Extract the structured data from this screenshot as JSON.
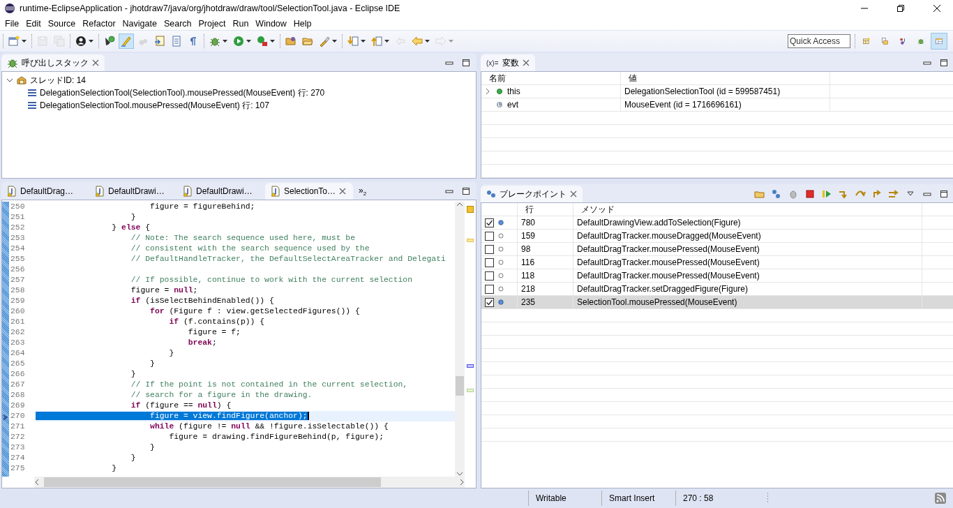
{
  "window": {
    "title": "runtime-EclipseApplication - jhotdraw7/java/org/jhotdraw/draw/tool/SelectionTool.java - Eclipse IDE"
  },
  "menu": [
    "File",
    "Edit",
    "Source",
    "Refactor",
    "Navigate",
    "Search",
    "Project",
    "Run",
    "Window",
    "Help"
  ],
  "toolbar": {
    "groups": [
      [
        {
          "kind": "new",
          "dropdown": true,
          "pressed": false,
          "disabled": false
        }
      ],
      [
        {
          "kind": "save",
          "dropdown": false,
          "pressed": false,
          "disabled": true
        },
        {
          "kind": "save-all",
          "dropdown": false,
          "pressed": false,
          "disabled": true
        }
      ],
      [
        {
          "kind": "profile",
          "dropdown": true,
          "pressed": false,
          "disabled": false
        }
      ],
      [
        {
          "kind": "pin",
          "dropdown": false,
          "pressed": false,
          "disabled": false
        },
        {
          "kind": "pen",
          "dropdown": false,
          "pressed": true,
          "disabled": false
        },
        {
          "kind": "cloud",
          "dropdown": false,
          "pressed": false,
          "disabled": true
        },
        {
          "kind": "doc-arrow",
          "dropdown": false,
          "pressed": false,
          "disabled": false
        },
        {
          "kind": "doc",
          "dropdown": false,
          "pressed": false,
          "disabled": false
        },
        {
          "kind": "pilcrow",
          "dropdown": false,
          "pressed": false,
          "disabled": false
        }
      ],
      [
        {
          "kind": "bug",
          "dropdown": true,
          "pressed": false,
          "disabled": false
        },
        {
          "kind": "play",
          "dropdown": true,
          "pressed": false,
          "disabled": false
        },
        {
          "kind": "play-box",
          "dropdown": true,
          "pressed": false,
          "disabled": false
        }
      ],
      [
        {
          "kind": "folder-open",
          "dropdown": false,
          "pressed": false,
          "disabled": false
        },
        {
          "kind": "folder",
          "dropdown": false,
          "pressed": false,
          "disabled": false
        },
        {
          "kind": "brush",
          "dropdown": true,
          "pressed": false,
          "disabled": false
        }
      ],
      [
        {
          "kind": "arrow-down",
          "dropdown": true,
          "pressed": false,
          "disabled": false
        },
        {
          "kind": "arrow-up",
          "dropdown": true,
          "pressed": false,
          "disabled": false
        },
        {
          "kind": "arrow-back",
          "dropdown": false,
          "pressed": false,
          "disabled": true
        },
        {
          "kind": "arrow-left",
          "dropdown": true,
          "pressed": false,
          "disabled": false
        },
        {
          "kind": "arrow-right",
          "dropdown": true,
          "pressed": false,
          "disabled": true
        }
      ]
    ]
  },
  "quick_access": {
    "placeholder": "Quick Access"
  },
  "perspectives": [
    {
      "kind": "perspective",
      "selected": false
    },
    {
      "kind": "folder-doc",
      "selected": false
    },
    {
      "kind": "git",
      "selected": false
    },
    {
      "kind": "bug",
      "selected": false
    },
    {
      "kind": "layout",
      "selected": true
    }
  ],
  "call_stack": {
    "title": "呼び出しスタック",
    "threads": [
      {
        "label": "スレッドID: 14",
        "expanded": true,
        "children": [
          {
            "label": "DelegationSelectionTool(SelectionTool).mousePressed(MouseEvent) 行: 270"
          },
          {
            "label": "DelegationSelectionTool.mousePressed(MouseEvent) 行: 107"
          }
        ]
      }
    ]
  },
  "variables": {
    "prefix": "(x)=",
    "title": "変数",
    "columns": [
      "名前",
      "値"
    ],
    "rows": [
      {
        "name": "this",
        "value": "DelegationSelectionTool  (id = 599587451)",
        "expandable": true,
        "kind": "field"
      },
      {
        "name": "evt",
        "value": "MouseEvent  (id = 1716696161)",
        "expandable": false,
        "kind": "local"
      }
    ]
  },
  "editor": {
    "tabs": [
      {
        "label": "DefaultDrag…",
        "selected": false
      },
      {
        "label": "DefaultDrawi…",
        "selected": false
      },
      {
        "label": "DefaultDrawi…",
        "selected": false
      },
      {
        "label": "SelectionTo…",
        "selected": true
      }
    ],
    "overflow": "»",
    "overflow_count": "2",
    "lines": [
      {
        "number": "250",
        "current": false,
        "segments": [
          {
            "kind": "code",
            "text": "                        figure = figureBehind;"
          }
        ]
      },
      {
        "number": "251",
        "current": false,
        "segments": [
          {
            "kind": "code",
            "text": "                    }"
          }
        ]
      },
      {
        "number": "252",
        "current": false,
        "segments": [
          {
            "kind": "code",
            "text": "                } "
          },
          {
            "kind": "keyword",
            "text": "else"
          },
          {
            "kind": "code",
            "text": " {"
          }
        ]
      },
      {
        "number": "253",
        "current": false,
        "segments": [
          {
            "kind": "comment",
            "text": "                    // Note: The search sequence used here, must be"
          }
        ]
      },
      {
        "number": "254",
        "current": false,
        "segments": [
          {
            "kind": "comment",
            "text": "                    // consistent with the search sequence used by the"
          }
        ]
      },
      {
        "number": "255",
        "current": false,
        "segments": [
          {
            "kind": "comment",
            "text": "                    // DefaultHandleTracker, the DefaultSelectAreaTracker and Delegati"
          }
        ]
      },
      {
        "number": "256",
        "current": false
      },
      {
        "number": "257",
        "current": false,
        "segments": [
          {
            "kind": "comment",
            "text": "                    // If possible, continue to work with the current selection"
          }
        ]
      },
      {
        "number": "258",
        "current": false,
        "segments": [
          {
            "kind": "code",
            "text": "                    figure = "
          },
          {
            "kind": "keyword",
            "text": "null"
          },
          {
            "kind": "code",
            "text": ";"
          }
        ]
      },
      {
        "number": "259",
        "current": false,
        "segments": [
          {
            "kind": "keyword",
            "text": "                    if"
          },
          {
            "kind": "code",
            "text": " (isSelectBehindEnabled()) {"
          }
        ]
      },
      {
        "number": "260",
        "current": false,
        "segments": [
          {
            "kind": "keyword",
            "text": "                        for"
          },
          {
            "kind": "code",
            "text": " (Figure f : view.getSelectedFigures()) {"
          }
        ]
      },
      {
        "number": "261",
        "current": false,
        "segments": [
          {
            "kind": "keyword",
            "text": "                            if"
          },
          {
            "kind": "code",
            "text": " (f.contains(p)) {"
          }
        ]
      },
      {
        "number": "262",
        "current": false,
        "segments": [
          {
            "kind": "code",
            "text": "                                figure = f;"
          }
        ]
      },
      {
        "number": "263",
        "current": false,
        "segments": [
          {
            "kind": "keyword",
            "text": "                                break"
          },
          {
            "kind": "code",
            "text": ";"
          }
        ]
      },
      {
        "number": "264",
        "current": false,
        "segments": [
          {
            "kind": "code",
            "text": "                            }"
          }
        ]
      },
      {
        "number": "265",
        "current": false,
        "segments": [
          {
            "kind": "code",
            "text": "                        }"
          }
        ]
      },
      {
        "number": "266",
        "current": false,
        "segments": [
          {
            "kind": "code",
            "text": "                    }"
          }
        ]
      },
      {
        "number": "267",
        "current": false,
        "segments": [
          {
            "kind": "comment",
            "text": "                    // If the point is not contained in the current selection,"
          }
        ]
      },
      {
        "number": "268",
        "current": false,
        "segments": [
          {
            "kind": "comment",
            "text": "                    // search for a figure in the drawing."
          }
        ]
      },
      {
        "number": "269",
        "current": false,
        "segments": [
          {
            "kind": "keyword",
            "text": "                    if"
          },
          {
            "kind": "code",
            "text": " (figure == "
          },
          {
            "kind": "keyword",
            "text": "null"
          },
          {
            "kind": "code",
            "text": ") {"
          }
        ]
      },
      {
        "number": "270",
        "current": true,
        "segments": [
          {
            "kind": "code",
            "text": "                        figure = view.findFigure(anchor);"
          }
        ]
      },
      {
        "number": "271",
        "current": false,
        "segments": [
          {
            "kind": "keyword",
            "text": "                        while"
          },
          {
            "kind": "code",
            "text": " (figure != "
          },
          {
            "kind": "keyword",
            "text": "null"
          },
          {
            "kind": "code",
            "text": " && !figure.isSelectable()) {"
          }
        ]
      },
      {
        "number": "272",
        "current": false,
        "segments": [
          {
            "kind": "code",
            "text": "                            figure = drawing.findFigureBehind(p, figure);"
          }
        ]
      },
      {
        "number": "273",
        "current": false,
        "segments": [
          {
            "kind": "code",
            "text": "                        }"
          }
        ]
      },
      {
        "number": "274",
        "current": false,
        "segments": [
          {
            "kind": "code",
            "text": "                    }"
          }
        ]
      },
      {
        "number": "275",
        "current": false,
        "segments": [
          {
            "kind": "code",
            "text": "                }"
          }
        ]
      }
    ]
  },
  "breakpoints": {
    "title": "ブレークポイント",
    "columns": [
      "行",
      "メソッド"
    ],
    "rows": [
      {
        "checked": true,
        "line": "780",
        "method": "DefaultDrawingView.addToSelection(Figure)",
        "selected": false
      },
      {
        "checked": false,
        "line": "159",
        "method": "DefaultDragTracker.mouseDragged(MouseEvent)",
        "selected": false
      },
      {
        "checked": false,
        "line": "98",
        "method": "DefaultDragTracker.mousePressed(MouseEvent)",
        "selected": false
      },
      {
        "checked": false,
        "line": "116",
        "method": "DefaultDragTracker.mousePressed(MouseEvent)",
        "selected": false
      },
      {
        "checked": false,
        "line": "118",
        "method": "DefaultDragTracker.mousePressed(MouseEvent)",
        "selected": false
      },
      {
        "checked": false,
        "line": "218",
        "method": "DefaultDragTracker.setDraggedFigure(Figure)",
        "selected": false
      },
      {
        "checked": true,
        "line": "235",
        "method": "SelectionTool.mousePressed(MouseEvent)",
        "selected": true
      }
    ]
  },
  "status_bar": [
    "Writable",
    "Smart Insert",
    "270 : 58"
  ]
}
